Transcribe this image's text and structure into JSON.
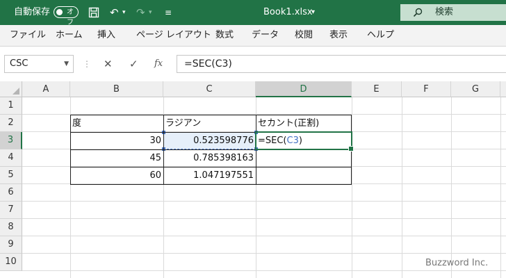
{
  "titlebar": {
    "autosave_label": "自動保存",
    "autosave_state": "オフ",
    "filename": "Book1.xlsx",
    "filename_caret": "▾",
    "search_placeholder": "検索",
    "bg_color": "#217346"
  },
  "ribbon": {
    "tabs": [
      "ファイル",
      "ホーム",
      "挿入",
      "ページ レイアウト",
      "数式",
      "データ",
      "校閲",
      "表示",
      "ヘルプ"
    ]
  },
  "formula_bar": {
    "name_box": "CSC",
    "fx_label": "fx",
    "formula": "=SEC(C3)"
  },
  "grid": {
    "columns": [
      "A",
      "B",
      "C",
      "D",
      "E",
      "F",
      "G"
    ],
    "rows": [
      "1",
      "2",
      "3",
      "4",
      "5",
      "6",
      "7",
      "8",
      "9",
      "10"
    ],
    "selected_column": "D",
    "selected_row": "3",
    "cells": {
      "B2": "度",
      "C2": "ラジアン",
      "D2": "セカント(正割)",
      "B3": "30",
      "C3": "0.523598776",
      "D3_prefix": "=SEC(",
      "D3_ref": "C3",
      "D3_suffix": ")",
      "B4": "45",
      "C4": "0.785398163",
      "B5": "60",
      "C5": "1.047197551"
    }
  },
  "watermark": "Buzzword Inc."
}
